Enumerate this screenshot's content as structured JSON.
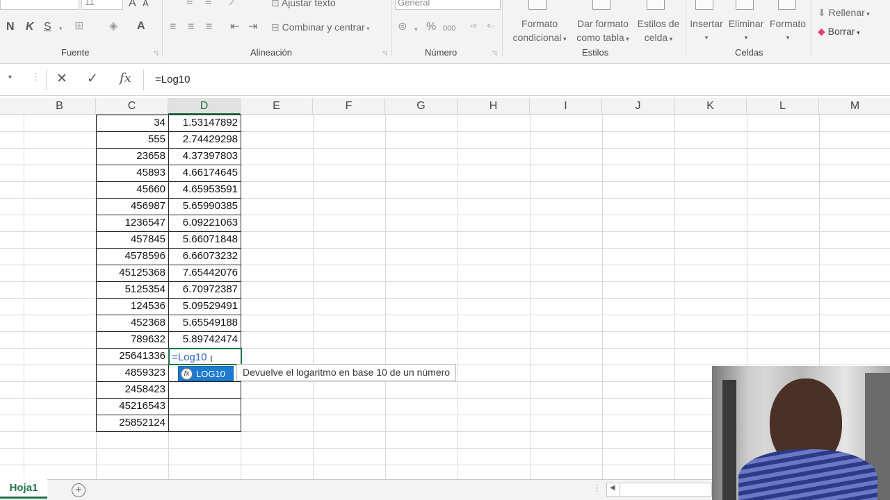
{
  "ribbon": {
    "font_size_value": "11",
    "bold": "N",
    "italic": "K",
    "underline": "S",
    "wrap_text": "Ajustar texto",
    "merge_center": "Combinar y centrar",
    "number_format": "General",
    "percent": "%",
    "thousands": "000",
    "cond_format_1": "Formato",
    "cond_format_2": "condicional",
    "table_format_1": "Dar formato",
    "table_format_2": "como tabla",
    "cell_styles_1": "Estilos de",
    "cell_styles_2": "celda",
    "insert": "Insertar",
    "delete": "Eliminar",
    "format": "Formato",
    "fill": "Rellenar",
    "clear": "Borrar",
    "groups": {
      "font": "Fuente",
      "alignment": "Alineación",
      "number": "Número",
      "styles": "Estilos",
      "cells": "Celdas"
    }
  },
  "formula_bar": {
    "value": "=Log10",
    "cancel": "✕",
    "enter": "✓",
    "fx": "fx"
  },
  "columns": [
    "B",
    "C",
    "D",
    "E",
    "F",
    "G",
    "H",
    "I",
    "J",
    "K",
    "L",
    "M"
  ],
  "selected_column": "D",
  "rows": [
    {
      "c": "34",
      "d": "1.53147892"
    },
    {
      "c": "555",
      "d": "2.74429298"
    },
    {
      "c": "23658",
      "d": "4.37397803"
    },
    {
      "c": "45893",
      "d": "4.66174645"
    },
    {
      "c": "45660",
      "d": "4.65953591"
    },
    {
      "c": "456987",
      "d": "5.65990385"
    },
    {
      "c": "1236547",
      "d": "6.09221063"
    },
    {
      "c": "457845",
      "d": "5.66071848"
    },
    {
      "c": "4578596",
      "d": "6.66073232"
    },
    {
      "c": "45125368",
      "d": "7.65442076"
    },
    {
      "c": "5125354",
      "d": "6.70972387"
    },
    {
      "c": "124536",
      "d": "5.09529491"
    },
    {
      "c": "452368",
      "d": "5.65549188"
    },
    {
      "c": "789632",
      "d": "5.89742474"
    },
    {
      "c": "25641336",
      "d": "=Log10"
    },
    {
      "c": "4859323",
      "d": ""
    },
    {
      "c": "2458423",
      "d": ""
    },
    {
      "c": "45216543",
      "d": ""
    },
    {
      "c": "25852124",
      "d": ""
    }
  ],
  "autocomplete": {
    "item": "LOG10",
    "tooltip": "Devuelve el logaritmo en base 10 de un número"
  },
  "sheet_tab": "Hoja1",
  "colors": {
    "accent": "#217346",
    "selection": "#1e7ad0",
    "formula_text": "#2a62c9"
  }
}
